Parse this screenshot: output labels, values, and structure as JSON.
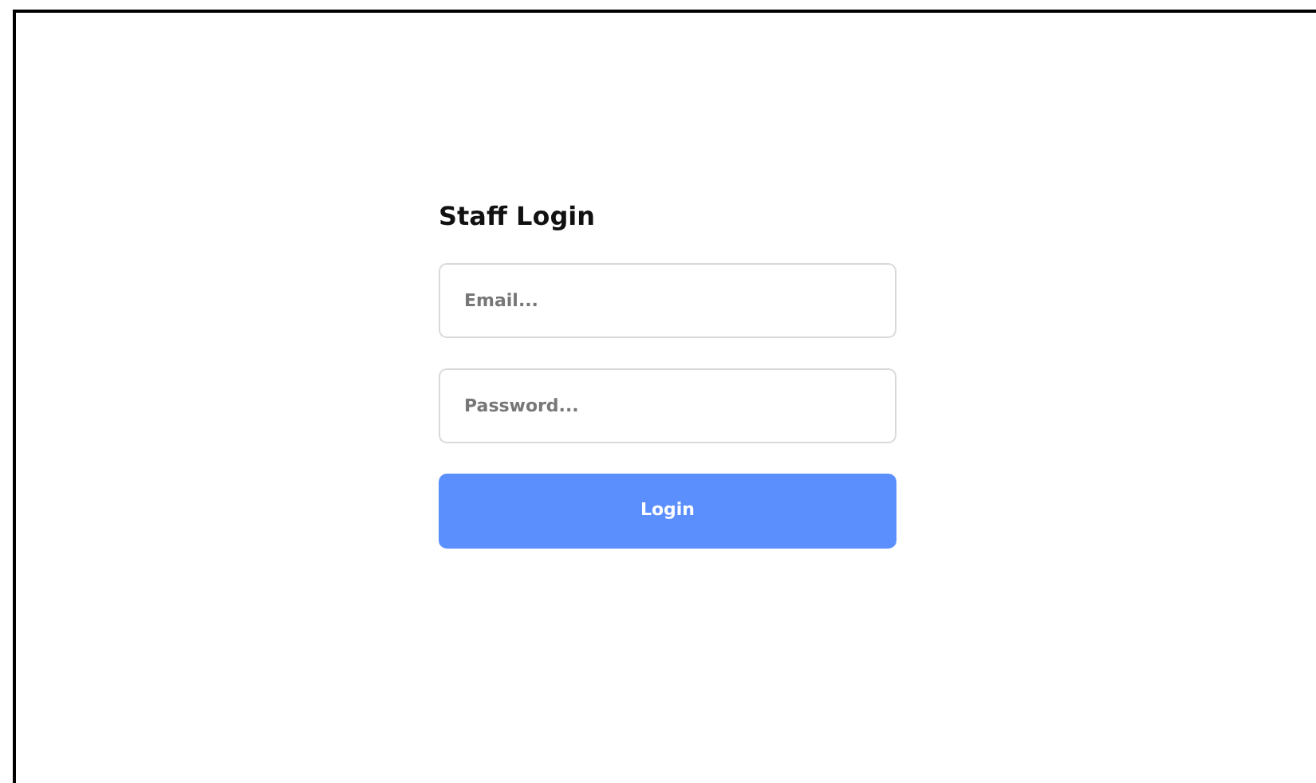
{
  "title": "Staff Login",
  "fields": [
    {
      "placeholder": "Email..."
    },
    {
      "placeholder": "Password..."
    }
  ],
  "buttons": [
    "Login"
  ]
}
